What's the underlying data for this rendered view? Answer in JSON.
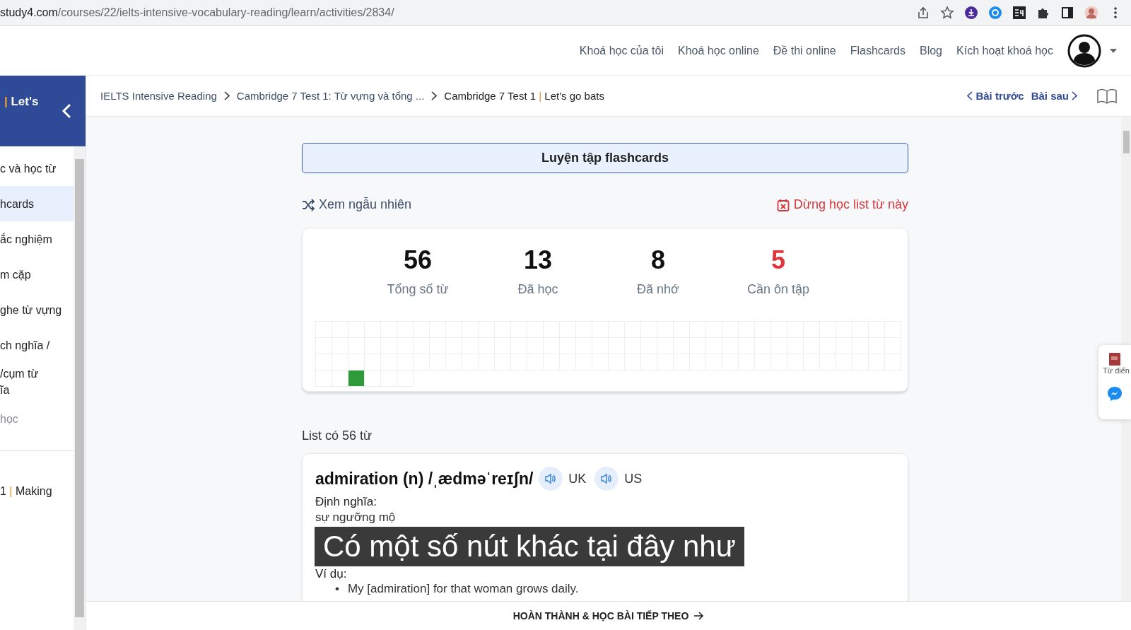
{
  "browser": {
    "url_domain": "study4.com",
    "url_path": "/courses/22/ielts-intensive-vocabulary-reading/learn/activities/2834/"
  },
  "nav": {
    "links": [
      "Khoá học của tôi",
      "Khoá học online",
      "Đề thi online",
      "Flashcards",
      "Blog",
      "Kích hoạt khoá học"
    ]
  },
  "sidebar": {
    "title_sep": "|",
    "title": "Let's",
    "items": [
      {
        "label": "c và học từ",
        "selected": false,
        "disabled": false
      },
      {
        "label": "hcards",
        "selected": true,
        "disabled": false
      },
      {
        "label": "ắc nghiệm",
        "selected": false,
        "disabled": false
      },
      {
        "label": "m cặp",
        "selected": false,
        "disabled": false
      },
      {
        "label": "ghe từ vựng",
        "selected": false,
        "disabled": false
      },
      {
        "label": "ch nghĩa /",
        "selected": false,
        "disabled": false
      },
      {
        "label": "/cụm từ\nĩa",
        "selected": false,
        "disabled": false
      },
      {
        "label": "học",
        "selected": false,
        "disabled": true
      }
    ],
    "next_lesson": {
      "prefix": "1",
      "sep": "|",
      "title": "Making"
    }
  },
  "breadcrumbs": [
    {
      "label": "IELTS Intensive Reading"
    },
    {
      "label": "Cambridge 7 Test 1: Từ vựng và tổng ..."
    },
    {
      "label": "Cambridge 7 Test 1",
      "sep": "|",
      "tail": "Let's go bats"
    }
  ],
  "pager": {
    "prev": "Bài trước",
    "next": "Bài sau"
  },
  "practice_button": "Luyện tập flashcards",
  "shuffle_link": "Xem ngẫu nhiên",
  "stop_link": "Dừng học list từ này",
  "stats": [
    {
      "value": "56",
      "label": "Tổng số từ",
      "color": "#111111"
    },
    {
      "value": "13",
      "label": "Đã học",
      "color": "#111111"
    },
    {
      "value": "8",
      "label": "Đã nhớ",
      "color": "#111111"
    },
    {
      "value": "5",
      "label": "Cần ôn tập",
      "color": "#e0353b"
    }
  ],
  "grid": [
    false,
    false,
    false,
    false,
    false,
    false,
    false,
    false,
    false,
    false,
    false,
    false,
    false,
    false,
    false,
    false,
    false,
    false,
    false,
    false,
    false,
    false,
    false,
    false,
    false,
    false,
    false,
    false,
    false,
    false,
    false,
    false,
    false,
    false,
    false,
    false,
    false,
    false,
    false,
    false,
    false,
    false,
    false,
    false,
    false,
    false,
    false,
    false,
    false,
    false,
    false,
    false,
    false,
    false,
    false,
    false,
    false,
    false,
    false,
    false,
    false,
    false,
    false,
    false,
    false,
    false,
    false,
    false,
    false,
    false,
    false,
    false,
    false,
    false,
    false,
    false,
    false,
    false,
    false,
    false,
    false,
    false,
    false,
    false,
    false,
    false,
    false,
    false,
    false,
    false,
    false,
    false,
    false,
    false,
    false,
    false,
    false,
    false,
    false,
    false,
    false,
    false,
    false,
    false,
    false,
    false,
    false,
    false,
    false,
    false,
    true,
    false,
    false,
    false
  ],
  "list_title": "List có 56 từ",
  "word": {
    "headword": "admiration (n) /ˌædməˈreɪʃn/",
    "audio": [
      {
        "label": "UK"
      },
      {
        "label": "US"
      }
    ],
    "definition_label": "Định nghĩa:",
    "definition": "sự ngưỡng mộ",
    "example_label": "Ví dụ:",
    "example_marker": "•",
    "examples": [
      "My [admiration] for that woman grows daily."
    ]
  },
  "subtitle": "Có một số nút khác tại đây như",
  "footer_button": "HOÀN THÀNH & HỌC BÀI TIẾP THEO",
  "side_widget": {
    "dictionary_label": "Từ điển"
  }
}
